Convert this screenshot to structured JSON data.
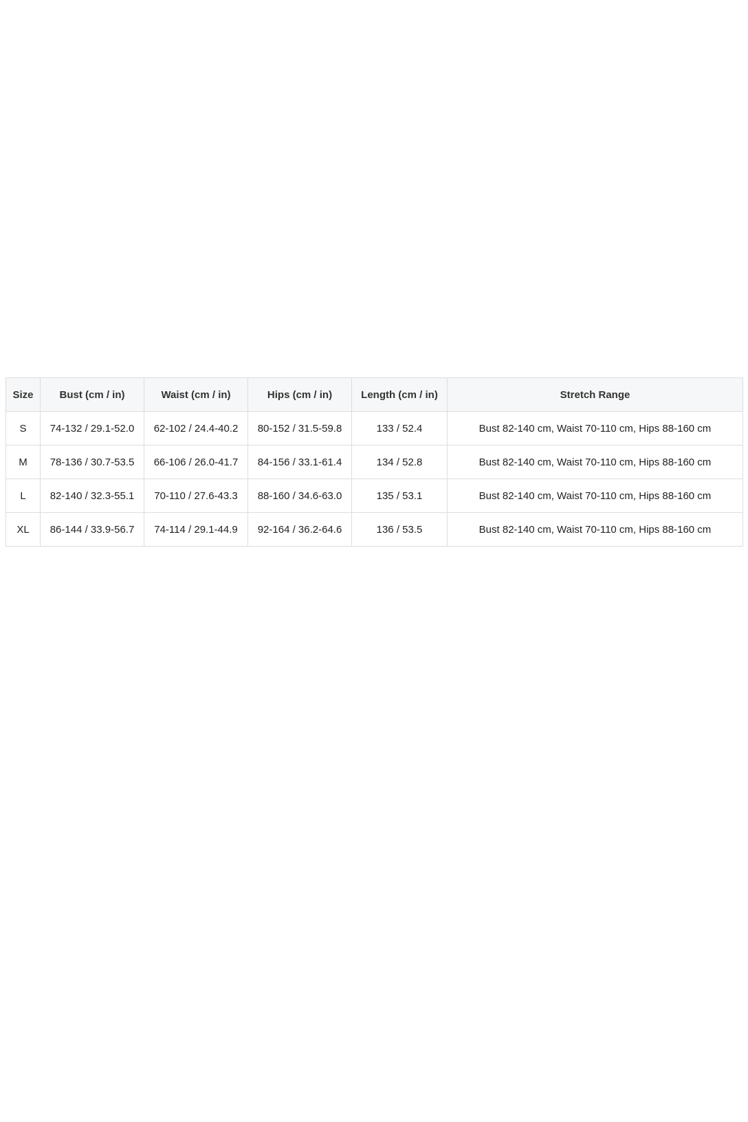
{
  "size_chart": {
    "headers": [
      "Size",
      "Bust (cm / in)",
      "Waist (cm / in)",
      "Hips (cm / in)",
      "Length (cm / in)",
      "Stretch Range"
    ],
    "rows": [
      [
        "S",
        "74-132 / 29.1-52.0",
        "62-102 / 24.4-40.2",
        "80-152 / 31.5-59.8",
        "133 / 52.4",
        "Bust 82-140 cm, Waist 70-110 cm, Hips 88-160 cm"
      ],
      [
        "M",
        "78-136 / 30.7-53.5",
        "66-106 / 26.0-41.7",
        "84-156 / 33.1-61.4",
        "134 / 52.8",
        "Bust 82-140 cm, Waist 70-110 cm, Hips 88-160 cm"
      ],
      [
        "L",
        "82-140 / 32.3-55.1",
        "70-110 / 27.6-43.3",
        "88-160 / 34.6-63.0",
        "135 / 53.1",
        "Bust 82-140 cm, Waist 70-110 cm, Hips 88-160 cm"
      ],
      [
        "XL",
        "86-144 / 33.9-56.7",
        "74-114 / 29.1-44.9",
        "92-164 / 36.2-64.6",
        "136 / 53.5",
        "Bust 82-140 cm, Waist 70-110 cm, Hips 88-160 cm"
      ]
    ]
  },
  "colors": {
    "header_background": "#f6f7f8",
    "border": "#dddddd",
    "text": "#222222"
  }
}
